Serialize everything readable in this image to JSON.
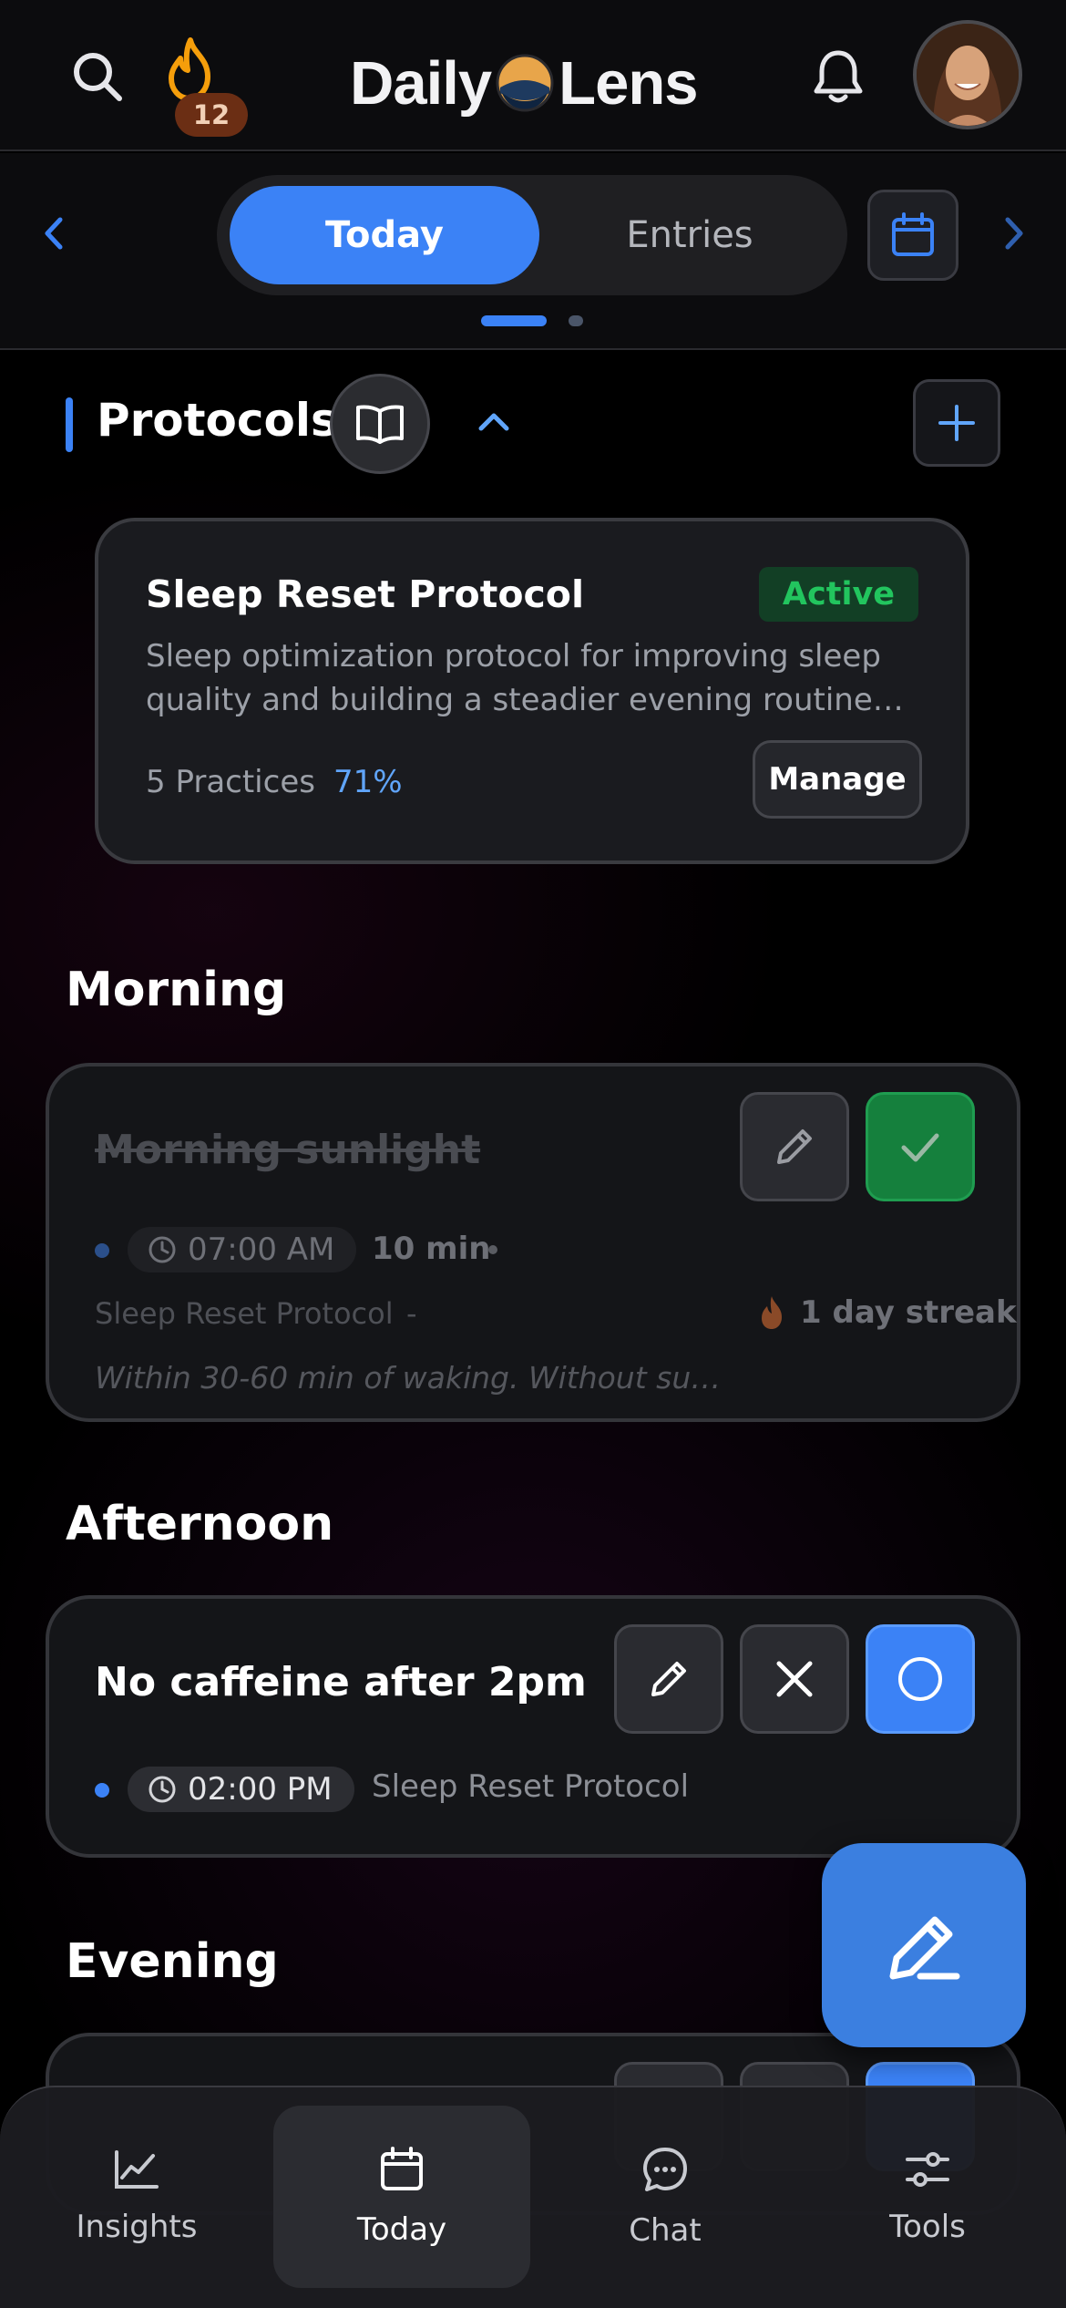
{
  "header": {
    "streak_count": "12",
    "logo_left": "Daily",
    "logo_right": "Lens"
  },
  "toolbar": {
    "tabs": [
      {
        "label": "Today",
        "active": true
      },
      {
        "label": "Entries",
        "active": false
      }
    ]
  },
  "protocols": {
    "title": "Protocols",
    "card": {
      "title": "Sleep Reset Protocol",
      "status": "Active",
      "description": "Sleep optimization protocol for improving sleep quality and building a steadier evening routine over…",
      "practices": "5 Practices",
      "progress": "71%",
      "manage_label": "Manage"
    }
  },
  "sections": [
    {
      "heading": "Morning",
      "tasks": [
        {
          "title": "Morning sunlight",
          "time": "07:00 AM",
          "duration": "10 min",
          "protocol": "Sleep Reset Protocol",
          "separator": "-",
          "streak": "1 day streak",
          "note": "Within 30-60 min of waking. Without su…",
          "status": "done"
        }
      ]
    },
    {
      "heading": "Afternoon",
      "tasks": [
        {
          "title": "No caffeine after 2pm",
          "time": "02:00 PM",
          "protocol": "Sleep Reset Protocol",
          "status": "pending"
        }
      ]
    },
    {
      "heading": "Evening",
      "tasks": []
    }
  ],
  "bottom_nav": [
    {
      "label": "Insights",
      "icon": "chart-line-icon",
      "active": false
    },
    {
      "label": "Today",
      "icon": "calendar-icon",
      "active": true
    },
    {
      "label": "Chat",
      "icon": "chat-bubble-icon",
      "active": false
    },
    {
      "label": "Tools",
      "icon": "sliders-icon",
      "active": false
    }
  ],
  "colors": {
    "accent": "#3b82f6",
    "success": "#22c55e",
    "streak": "#f59e0b"
  }
}
